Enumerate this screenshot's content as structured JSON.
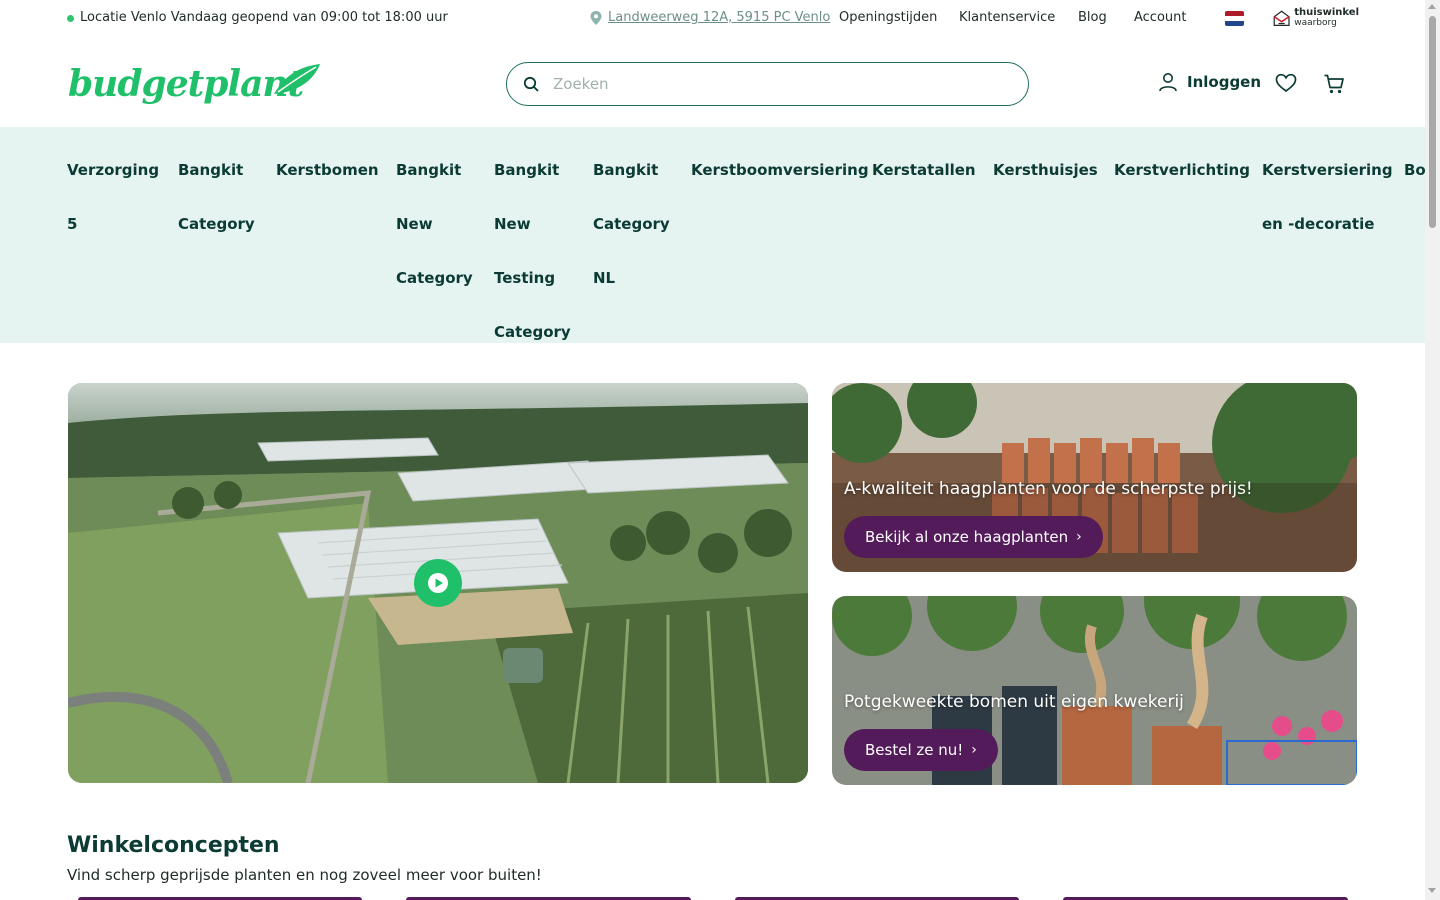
{
  "topbar": {
    "status_location": "Locatie Venlo",
    "status_hours": "Vandaag geopend van 09:00 tot 18:00 uur",
    "address": "Landweerweg 12A, 5915 PC Venlo",
    "links": [
      "Openingstijden",
      "Klantenservice",
      "Blog",
      "Account"
    ],
    "trust_seal_line1": "thuiswinkel",
    "trust_seal_line2": "waarborg"
  },
  "header": {
    "logo_text": "budgetplant",
    "search_placeholder": "Zoeken",
    "login_label": "Inloggen"
  },
  "categories": [
    [
      "Verzorging",
      "5"
    ],
    [
      "Bangkit",
      "Category"
    ],
    [
      "Kerstbomen"
    ],
    [
      "Bangkit",
      "New",
      "Category"
    ],
    [
      "Bangkit",
      "New",
      "Testing",
      "Category"
    ],
    [
      "Bangkit",
      "Category",
      "NL"
    ],
    [
      "Kerstboomversiering"
    ],
    [
      "Kerstatallen"
    ],
    [
      "Kersthuisjes"
    ],
    [
      "Kerstverlichting"
    ],
    [
      "Kerstversiering",
      "en -decoratie"
    ],
    [
      "Bon"
    ]
  ],
  "hero": {
    "promo1_title": "A-kwaliteit haagplanten voor de scherpste prijs!",
    "promo1_button": "Bekijk al onze haagplanten",
    "promo2_title": "Potgekweekte bomen uit eigen kwekerij",
    "promo2_button": "Bestel ze nu!"
  },
  "concepts": {
    "title": "Winkelconcepten",
    "subtitle": "Vind scherp geprijsde planten en nog zoveel meer voor buiten!"
  },
  "colors": {
    "brand_green": "#20c06a",
    "dark_teal": "#0b3b34",
    "nav_bg": "#e5f3f1",
    "button_purple": "#541b5b"
  }
}
